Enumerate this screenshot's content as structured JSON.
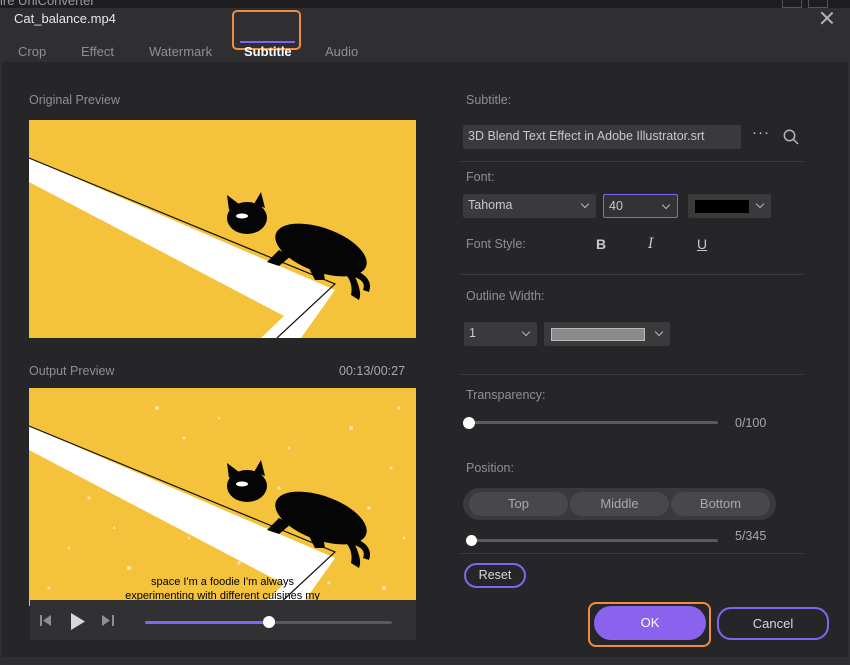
{
  "background_app": {
    "title": "ire UniConverter"
  },
  "dialog": {
    "title": "Cat_balance.mp4"
  },
  "tabs": [
    {
      "label": "Crop"
    },
    {
      "label": "Effect"
    },
    {
      "label": "Watermark"
    },
    {
      "label": "Subtitle"
    },
    {
      "label": "Audio"
    }
  ],
  "active_tab": "Subtitle",
  "preview": {
    "original_label": "Original Preview",
    "output_label": "Output Preview",
    "timecode": "00:13/00:27",
    "subtitle_line1": "space I'm a foodie I'm always",
    "subtitle_line2": "experimenting with different cuisines my",
    "playback_progress": 0.5
  },
  "settings": {
    "subtitle_label": "Subtitle:",
    "subtitle_file": "3D Blend Text Effect in Adobe Illustrator.srt",
    "font_label": "Font:",
    "font_name": "Tahoma",
    "font_size": "40",
    "font_color": "#000000",
    "font_style_label": "Font Style:",
    "bold_label": "B",
    "italic_label": "I",
    "underline_label": "U",
    "outline_width_label": "Outline Width:",
    "outline_width": "1",
    "outline_color": "#8a8a8d",
    "transparency_label": "Transparency:",
    "transparency_value": "0/100",
    "position_label": "Position:",
    "position_options": [
      "Top",
      "Middle",
      "Bottom"
    ],
    "position_value": "5/345",
    "reset_label": "Reset"
  },
  "footer": {
    "ok_label": "OK",
    "cancel_label": "Cancel"
  },
  "colors": {
    "accent": "#7b68ee",
    "highlight": "#f08c3c",
    "preview_bg": "#f5c33b"
  }
}
